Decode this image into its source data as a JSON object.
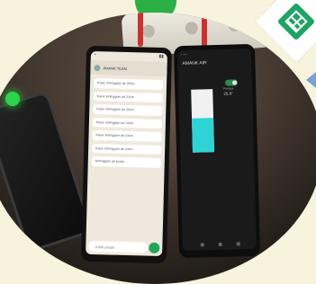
{
  "scene": {
    "accent_green": "#2bb046",
    "sheets_green": "#1fa463",
    "water_cyan": "#2ed3d6"
  },
  "phone_whatsapp": {
    "contact": "AMANK TEAM",
    "messages": [
      "Kaya: ketinggian air 25cm...",
      "Kaya: ketinggian air 23cm",
      "Kaya: ketinggian air 24cm",
      "Kaya: ketinggian air 23cm",
      "Kaya: ketinggian air 23cm",
      "Kaya: ketinggian air 24cm",
      "Ketinggian air berisi..."
    ],
    "input_placeholder": "Ketik pesan"
  },
  "phone_app": {
    "title": "AMANK AIR",
    "toggle_label": "Pompa",
    "temperature": "25.8°",
    "water_level_fraction": 0.55
  },
  "icons": {
    "sheets": "google-sheets-icon",
    "chevron": "chevron-left-icon",
    "led": "status-led-icon"
  }
}
